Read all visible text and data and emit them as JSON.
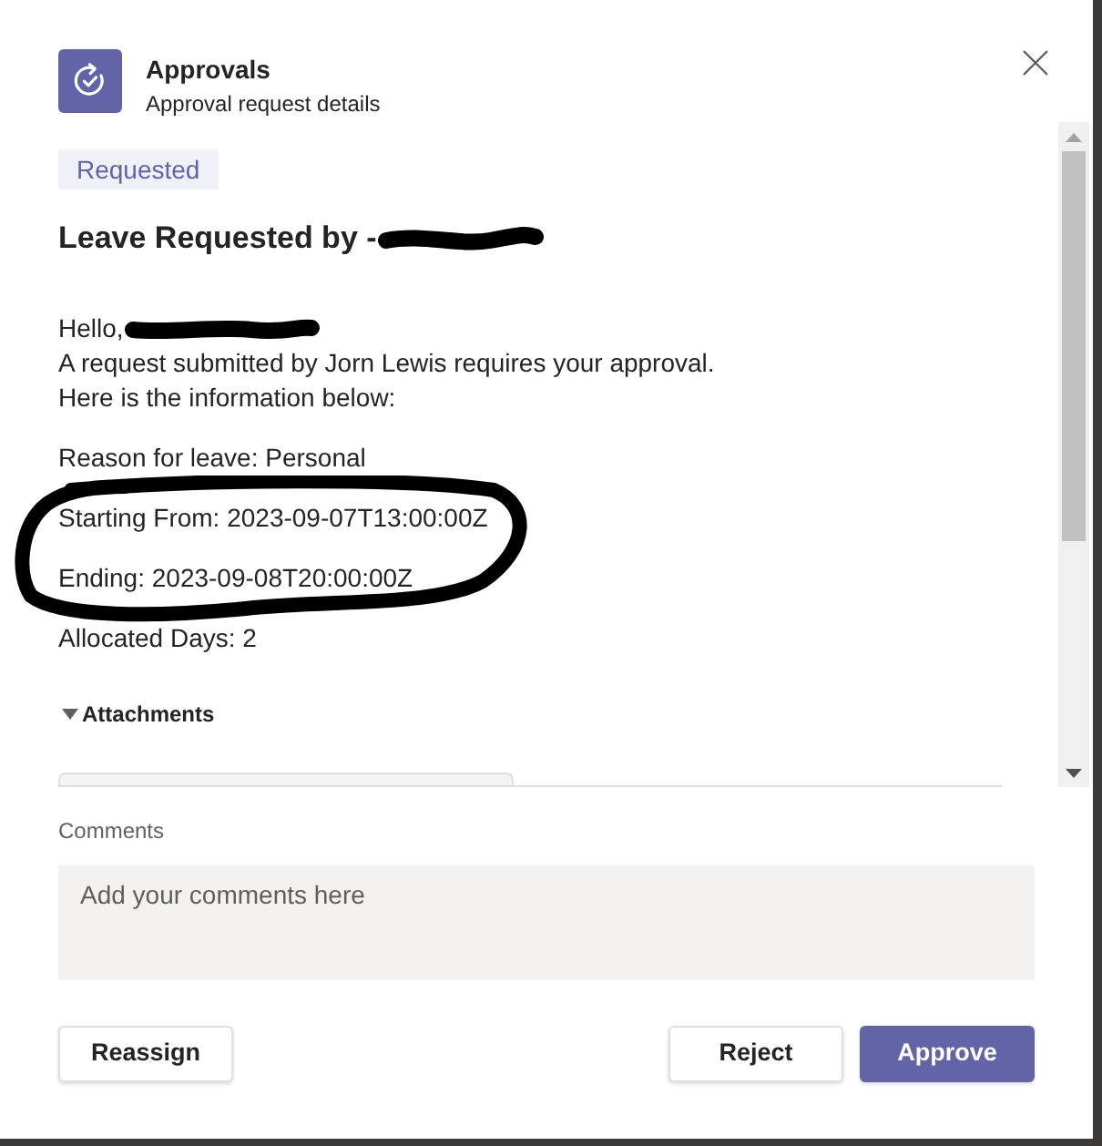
{
  "dialog": {
    "app_name": "Approvals",
    "subtitle": "Approval request details"
  },
  "status_badge": {
    "label": "Requested"
  },
  "request": {
    "title": "Leave Requested by -",
    "title_redacted": true,
    "greeting_lines": [
      {
        "text": "Hello,",
        "redacted": true
      },
      {
        "text": "A request submitted by Jorn Lewis requires your approval.",
        "redacted": false
      },
      {
        "text": "Here is the information below:",
        "redacted": false
      }
    ],
    "details": [
      {
        "text": "Reason for leave: Personal",
        "circled": false
      },
      {
        "text": "Starting From: 2023-09-07T13:00:00Z",
        "circled": true
      },
      {
        "text": "Ending: 2023-09-08T20:00:00Z",
        "circled": true
      },
      {
        "text": "Allocated Days: 2",
        "circled": false
      }
    ]
  },
  "attachments": {
    "label": "Attachments",
    "expanded": true
  },
  "comments": {
    "label": "Comments",
    "placeholder": "Add your comments here"
  },
  "buttons": [
    {
      "label": "Reassign",
      "kind": "secondary"
    },
    {
      "label": "Reject",
      "kind": "secondary"
    },
    {
      "label": "Approve",
      "kind": "primary"
    }
  ]
}
